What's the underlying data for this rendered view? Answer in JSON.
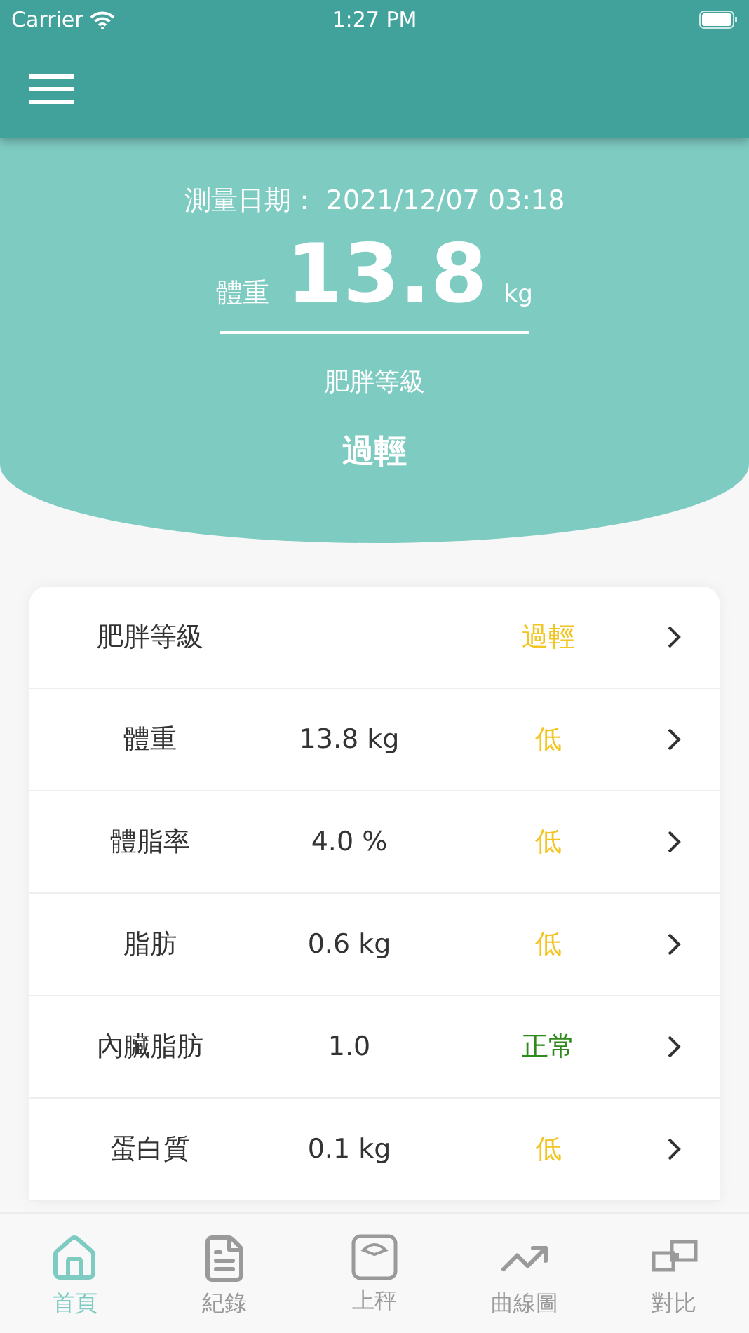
{
  "status_bar": {
    "carrier": "Carrier",
    "time": "1:27 PM"
  },
  "summary": {
    "date": "測量日期： 2021/12/07 03:18",
    "weight_label": "體重",
    "weight_value": "13.8",
    "weight_unit": "kg",
    "level_label": "肥胖等級",
    "level_value": "過輕"
  },
  "rows": [
    {
      "label": "肥胖等級",
      "status": "過輕",
      "color": "#f2c523"
    },
    {
      "label": "體重",
      "value": "13.8 kg",
      "status": "低",
      "color": "#f2c523"
    },
    {
      "label": "體脂率",
      "value": "4.0 %",
      "status": "低",
      "color": "#f2c523"
    },
    {
      "label": "脂肪",
      "value": "0.6 kg",
      "status": "低",
      "color": "#f2c523"
    },
    {
      "label": "內臟脂肪",
      "value": "1.0",
      "status": "正常",
      "color": "#2f8a1c"
    },
    {
      "label": "蛋白質",
      "value": "0.1 kg",
      "status": "低",
      "color": "#f2c523"
    }
  ],
  "tabs": [
    {
      "label": "首頁",
      "kind": "home",
      "selected": true
    },
    {
      "label": "紀錄",
      "kind": "records",
      "selected": false
    },
    {
      "label": "上秤",
      "kind": "scale",
      "selected": false
    },
    {
      "label": "曲線圖",
      "kind": "trend",
      "selected": false
    },
    {
      "label": "對比",
      "kind": "compare",
      "selected": false
    }
  ]
}
